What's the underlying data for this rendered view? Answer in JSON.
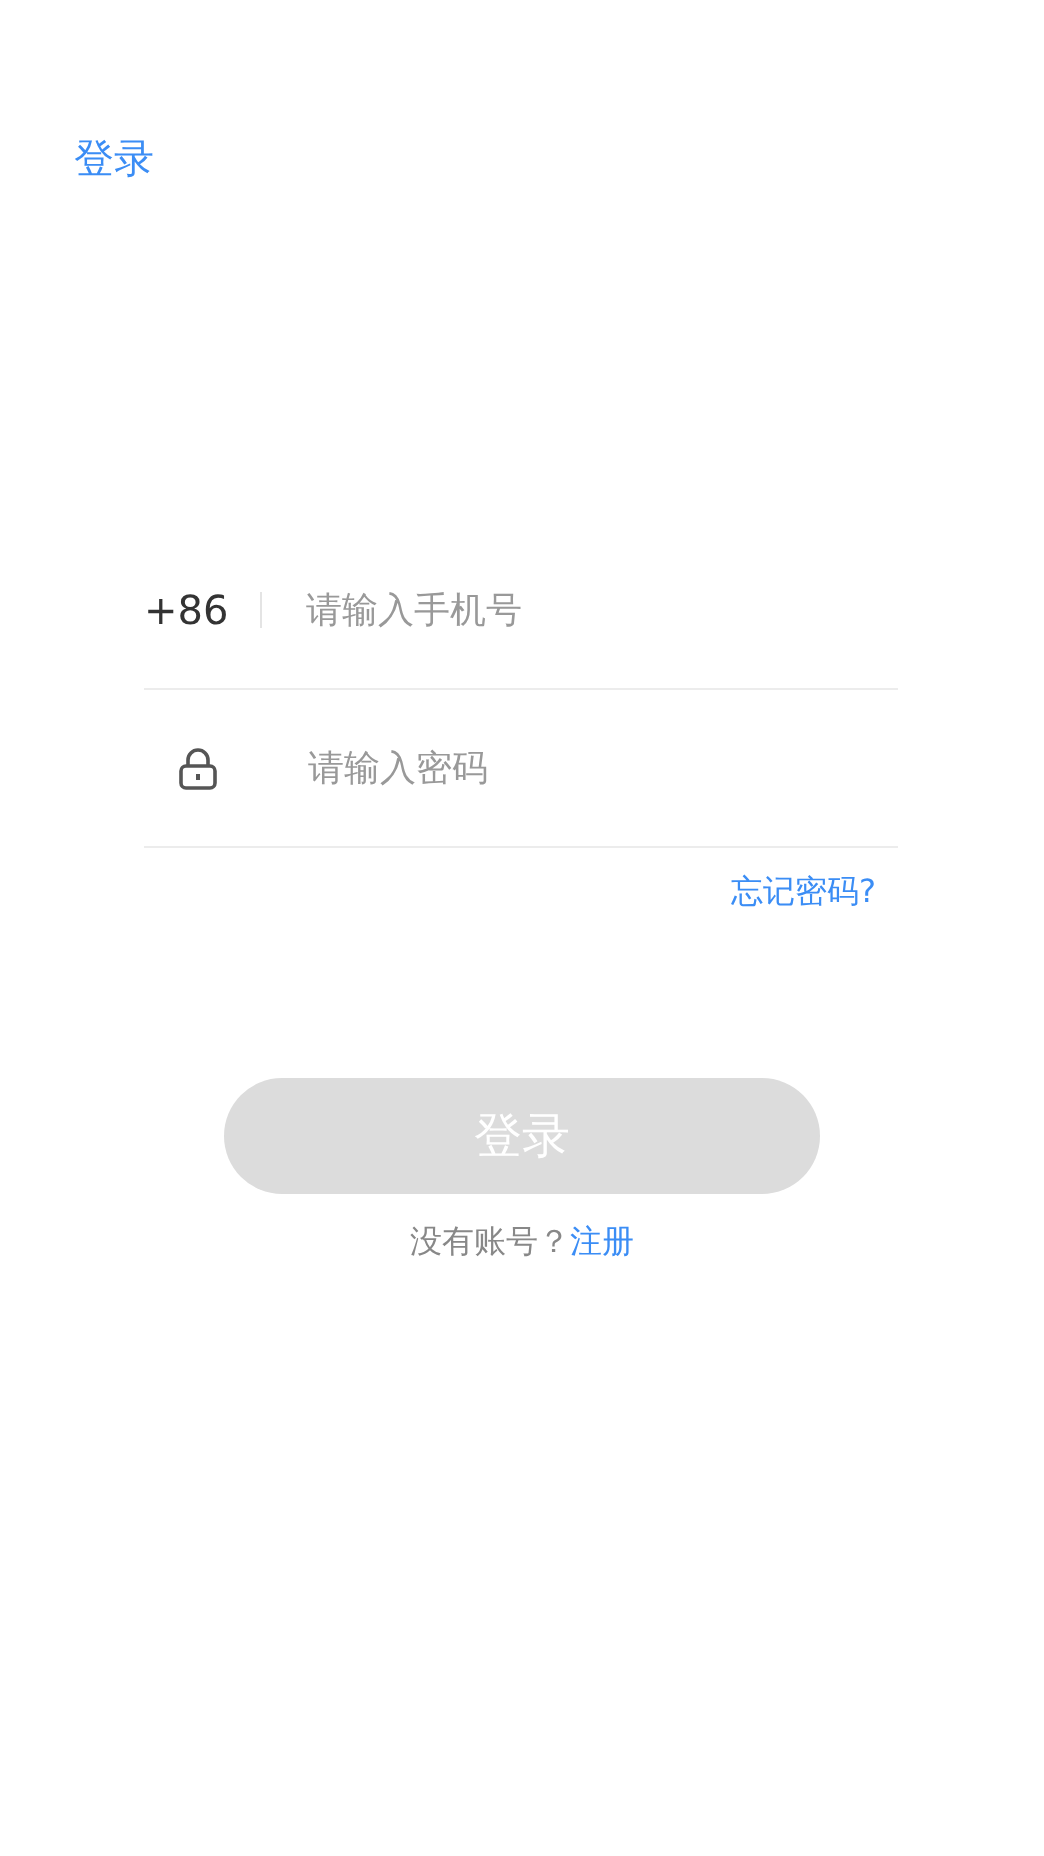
{
  "header": {
    "title": "登录"
  },
  "phone_field": {
    "country_code": "+86",
    "placeholder": "请输入手机号"
  },
  "password_field": {
    "placeholder": "请输入密码"
  },
  "forgot_link": "忘记密码?",
  "login_button": {
    "label": "登录",
    "disabled": true
  },
  "signup": {
    "prompt": "没有账号？",
    "link": "注册"
  }
}
